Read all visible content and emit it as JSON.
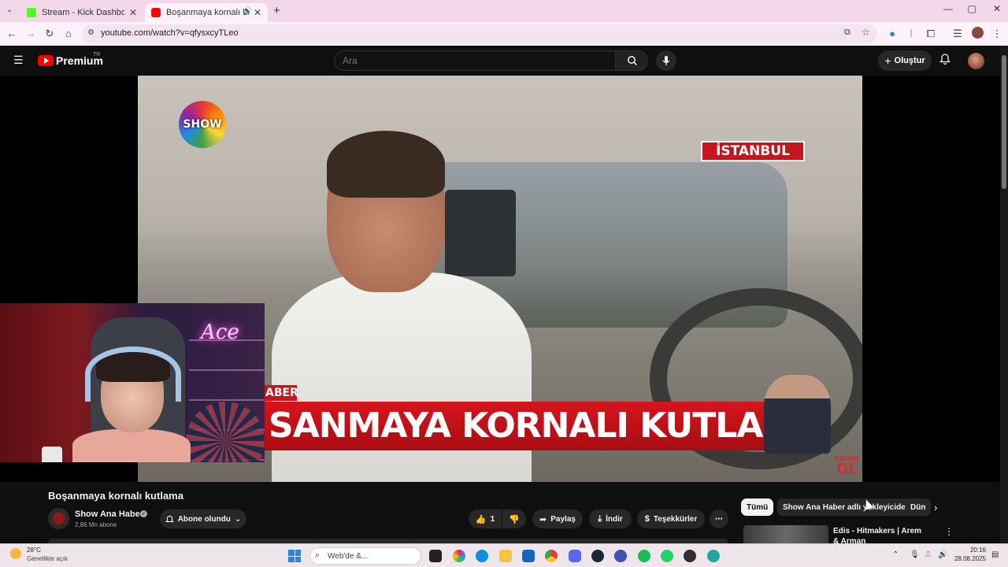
{
  "browser": {
    "tabs": [
      {
        "title": "Stream - Kick Dashboard",
        "close": "✕"
      },
      {
        "title": "Boşanmaya kornalı kutlama",
        "close": "✕"
      }
    ],
    "new_tab": "+",
    "url": "youtube.com/watch?v=qfysxcyTLeo",
    "window_controls": {
      "minimize": "—",
      "maximize": "▢",
      "close": "✕"
    }
  },
  "youtube": {
    "logo_text": "Premium",
    "logo_region": "TR",
    "search_placeholder": "Ara",
    "create_label": "Oluştur",
    "create_icon": "+"
  },
  "video": {
    "channel_logo": "SHOW",
    "city_tag": "İSTANBUL",
    "news_kicker": "ABER",
    "news_banner": "SANMAYA KORNALI KUTLAMA",
    "abone_top": "ABONE",
    "abone_bottom": "OL",
    "webcam_neon": "Ace"
  },
  "watch": {
    "title": "Boşanmaya kornalı kutlama",
    "channel_name": "Show Ana Haber",
    "verified": "✓",
    "subscribers": "2,86 Mn abone",
    "subscribed_label": "Abone olundu",
    "like_count": "1",
    "share_label": "Paylaş",
    "download_label": "İndir",
    "thanks_label": "Teşekkürler",
    "more_label": "⋯"
  },
  "sidebar": {
    "chips": [
      "Tümü",
      "Show Ana Haber adlı yükleyiciden",
      "Dün"
    ],
    "next": "›",
    "recommendation_title": "Edis - Hitmakers | Arem & Arman",
    "rec_menu": "⋮"
  },
  "taskbar": {
    "temperature": "28°C",
    "weather": "Genellikle açık",
    "search_placeholder": "Web'de &...",
    "time": "20:16",
    "date": "28.08.2025"
  },
  "colors": {
    "youtube_red": "#ff0000",
    "news_red": "#c6161d",
    "page_bg": "#0f0f0f",
    "tab_strip": "#f2d8e9"
  },
  "icons": [
    "menu-icon",
    "search-icon",
    "mic-icon",
    "bell-icon",
    "like-icon",
    "dislike-icon",
    "share-icon",
    "download-icon",
    "thanks-icon",
    "back-icon",
    "forward-icon",
    "reload-icon",
    "home-icon",
    "star-icon",
    "extensions-icon"
  ]
}
